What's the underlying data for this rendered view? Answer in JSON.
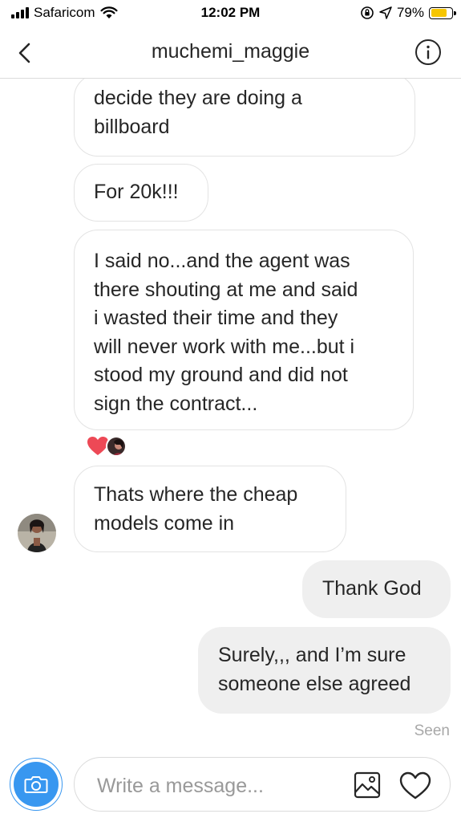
{
  "status_bar": {
    "carrier": "Safaricom",
    "time": "12:02 PM",
    "battery": "79%",
    "battery_level": 0.79
  },
  "header": {
    "title": "muchemi_maggie",
    "back_icon": "chevron-left-icon",
    "info_icon": "info-icon"
  },
  "messages": [
    {
      "from": "them",
      "lines": [
        "decide they are doing a",
        "billboard"
      ]
    },
    {
      "from": "them",
      "lines": [
        "For 20k!!!"
      ]
    },
    {
      "from": "them",
      "lines": [
        "I said no...and the agent was",
        "there shouting at me and said",
        "i wasted their time and they",
        "will never work with me...but i",
        "stood my ground and did not",
        "sign the contract..."
      ]
    },
    {
      "from": "them",
      "lines": [
        "Thats where the cheap",
        "models come in"
      ]
    },
    {
      "from": "me",
      "lines": [
        "Thank God"
      ]
    },
    {
      "from": "me",
      "lines": [
        "Surely,,, and I’m sure",
        "someone else agreed"
      ]
    }
  ],
  "reaction": {
    "icon": "heart-icon",
    "color": "#ed4956"
  },
  "seen_label": "Seen",
  "composer": {
    "placeholder": "Write a message...",
    "camera_icon": "camera-icon",
    "gallery_icon": "gallery-icon",
    "like_icon": "heart-outline-icon"
  },
  "colors": {
    "accent": "#3897f0",
    "battery": "#f7c600",
    "bubble_out": "#efefef"
  }
}
